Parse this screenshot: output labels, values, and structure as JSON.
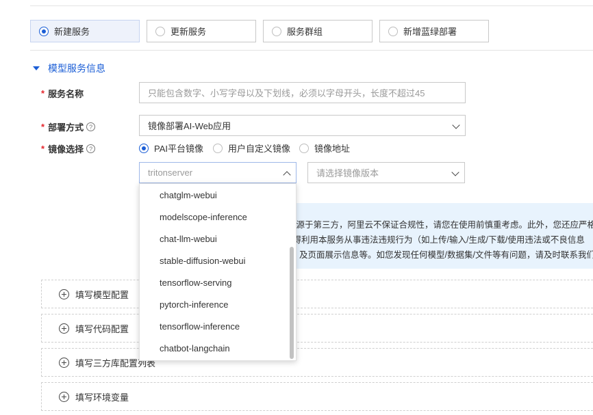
{
  "deploy_mode": {
    "options": [
      {
        "label": "新建服务",
        "selected": true
      },
      {
        "label": "更新服务",
        "selected": false
      },
      {
        "label": "服务群组",
        "selected": false
      },
      {
        "label": "新增蓝绿部署",
        "selected": false
      }
    ]
  },
  "section": {
    "title": "模型服务信息"
  },
  "form": {
    "service_name": {
      "label": "服务名称",
      "required_mark": "*",
      "placeholder": "只能包含数字、小写字母以及下划线，必须以字母开头，长度不超过45"
    },
    "deploy_method": {
      "label": "部署方式",
      "required_mark": "*",
      "value": "镜像部署AI-Web应用",
      "help_icon": "question-circle-icon"
    },
    "image_select": {
      "label": "镜像选择",
      "required_mark": "*",
      "help_icon": "question-circle-icon",
      "options": [
        {
          "label": "PAI平台镜像",
          "selected": true
        },
        {
          "label": "用户自定义镜像",
          "selected": false
        },
        {
          "label": "镜像地址",
          "selected": false
        }
      ],
      "image_search": {
        "value": "tritonserver"
      },
      "version": {
        "placeholder": "请选择镜像版本"
      }
    }
  },
  "dropdown": {
    "items": [
      "chatglm-webui",
      "modelscope-inference",
      "chat-llm-webui",
      "stable-diffusion-webui",
      "tensorflow-serving",
      "pytorch-inference",
      "tensorflow-inference",
      "chatbot-langchain"
    ]
  },
  "notice": {
    "lines": [
      "来源于第三方，阿里云不保证合规性，请您在使用前慎重考虑。此外，您还应严格遵",
      "不得利用本服务从事违法违规行为（如上传/输入/生成/下载/使用违法或不良信息",
      "及页面展示信息等。如您发现任何模型/数据集/文件等有问题，请及时联系我们处"
    ]
  },
  "collapsible_sections": [
    {
      "label": "填写模型配置"
    },
    {
      "label": "填写代码配置"
    },
    {
      "label": "填写三方库配置列表"
    },
    {
      "label": "填写环境变量"
    }
  ],
  "colors": {
    "accent": "#1b5ed6",
    "required": "#e5262d",
    "notice_bg": "#e8f3fd"
  }
}
